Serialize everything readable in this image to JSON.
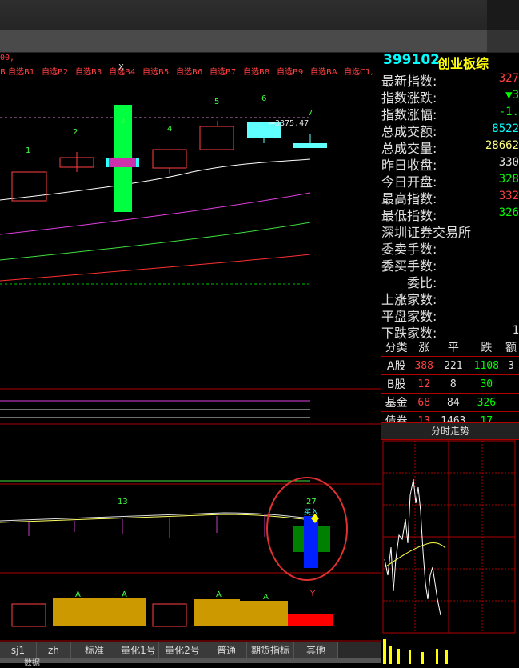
{
  "toolbar": {
    "formula_label": "00,"
  },
  "chart": {
    "watchlist_labels": [
      "B",
      "自选B1",
      "自选B2",
      "自选B3",
      "自选B4",
      "自选B5",
      "自选B6",
      "自选B7",
      "自选B8",
      "自选B9",
      "自选BA",
      "自选C1,"
    ],
    "price_annotation": "3375.47",
    "candle_numbers": [
      "1",
      "2",
      "3",
      "4",
      "5",
      "6",
      "7"
    ],
    "volume_labels": {
      "n13": "13",
      "n27": "27",
      "a": "A",
      "y": "Y",
      "small": "买入"
    },
    "top_marker": "X"
  },
  "tabs": [
    "sj1",
    "zh",
    "标准",
    "量化1号",
    "量化2号",
    "普通",
    "期货指标",
    "其他"
  ],
  "sub_tab_label": "数据",
  "quote": {
    "code": "399102",
    "name": "创业板综",
    "rows": [
      {
        "label": "最新指数:",
        "value": "327",
        "color": "#ff4040"
      },
      {
        "label": "指数涨跌:",
        "value": "▼3",
        "color": "#00ff00"
      },
      {
        "label": "指数涨幅:",
        "value": "-1.",
        "color": "#00ff00"
      },
      {
        "label": "总成交额:",
        "value": "8522",
        "color": "#00ffff"
      },
      {
        "label": "总成交量:",
        "value": "28662",
        "color": "#ffff80"
      },
      {
        "label": "昨日收盘:",
        "value": "330",
        "color": "#e0e0e0"
      },
      {
        "label": "今日开盘:",
        "value": "328",
        "color": "#00ff00"
      },
      {
        "label": "最高指数:",
        "value": "332",
        "color": "#ff4040"
      },
      {
        "label": "最低指数:",
        "value": "326",
        "color": "#00ff00"
      }
    ],
    "exchange": "深圳证券交易所",
    "rows2": [
      {
        "label": "委卖手数:",
        "value": ""
      },
      {
        "label": "委买手数:",
        "value": ""
      },
      {
        "label": "委比:",
        "value": ""
      },
      {
        "label": "上涨家数:",
        "value": ""
      },
      {
        "label": "平盘家数:",
        "value": ""
      },
      {
        "label": "下跌家数:",
        "value": "1"
      }
    ],
    "table_headers": [
      "分类",
      "涨",
      "平",
      "跌",
      "额"
    ],
    "table_rows": [
      {
        "name": "A股",
        "up": "388",
        "flat": "221",
        "down": "1108",
        "amt": "3"
      },
      {
        "name": "B股",
        "up": "12",
        "flat": "8",
        "down": "30",
        "amt": ""
      },
      {
        "name": "基金",
        "up": "68",
        "flat": "84",
        "down": "326",
        "amt": ""
      },
      {
        "name": "债券",
        "up": "13",
        "flat": "1463",
        "down": "17",
        "amt": ""
      }
    ],
    "intraday_title": "分时走势"
  },
  "colors": {
    "up": "#ff4040",
    "down": "#00ff00",
    "cyan": "#00ffff",
    "panel_border": "#b00000"
  }
}
